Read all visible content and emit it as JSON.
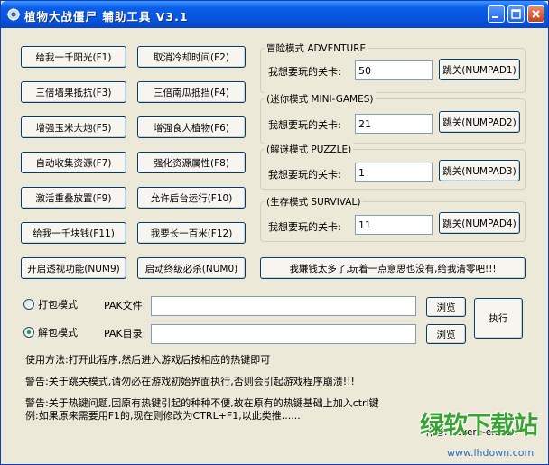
{
  "window": {
    "title": "植物大战僵尸 辅助工具 V3.1",
    "accent": "#0a5ee8",
    "face": "#ece9d8"
  },
  "left_buttons": [
    [
      "给我一千阳光(F1)",
      "取消冷却时间(F2)"
    ],
    [
      "三倍墙果抵抗(F3)",
      "三倍南瓜抵挡(F4)"
    ],
    [
      "增强玉米大炮(F5)",
      "增强食人植物(F6)"
    ],
    [
      "自动收集资源(F7)",
      "强化资源属性(F8)"
    ],
    [
      "激活重叠放置(F9)",
      "允许后台运行(F10)"
    ],
    [
      "给我一千块钱(F11)",
      "我要长一百米(F12)"
    ],
    [
      "开启透视功能(NUM9)",
      "启动终级必杀(NUM0)"
    ]
  ],
  "modes": [
    {
      "title": "冒险模式 ADVENTURE",
      "label": "我想要玩的关卡:",
      "value": "50",
      "button": "跳关(NUMPAD1)"
    },
    {
      "title": "(迷你模式 MINI-GAMES)",
      "label": "我想要玩的关卡:",
      "value": "21",
      "button": "跳关(NUMPAD2)"
    },
    {
      "title": "(解谜模式 PUZZLE)",
      "label": "我想要玩的关卡:",
      "value": "1",
      "button": "跳关(NUMPAD3)"
    },
    {
      "title": "(生存模式 SURVIVAL)",
      "label": "我想要玩的关卡:",
      "value": "11",
      "button": "跳关(NUMPAD4)"
    }
  ],
  "clear_money_button": "我嫌钱太多了,玩着一点意思也没有,给我清零吧!!!",
  "pak": {
    "pack_radio": "打包模式",
    "unpack_radio": "解包模式",
    "selected": "unpack",
    "file_label": "PAK文件:",
    "dir_label": "PAK目录:",
    "file_value": "",
    "dir_value": "",
    "browse": "浏览",
    "execute": "执行"
  },
  "notes": {
    "usage": "使用方法:打开此程序,然后进入游戏后按相应的热键即可",
    "warning1": "警告:关于跳关模式,请勿必在游戏初始界面执行,否则会引起游戏程序崩溃!!!",
    "warning2_line1": "警告:关于热键问题,因原有热键引起的种种不便,故在原有的热键基础上加入ctrl键",
    "warning2_line2": "例:如果原来需要用F1的,现在则修改为CTRL+F1,以此类推......",
    "author": "作者: severe-eleven"
  },
  "watermark": {
    "brand": "绿软下载站",
    "url": "www.lhdown.com",
    "green": "#3aa235",
    "orange": "#f08a1c"
  }
}
